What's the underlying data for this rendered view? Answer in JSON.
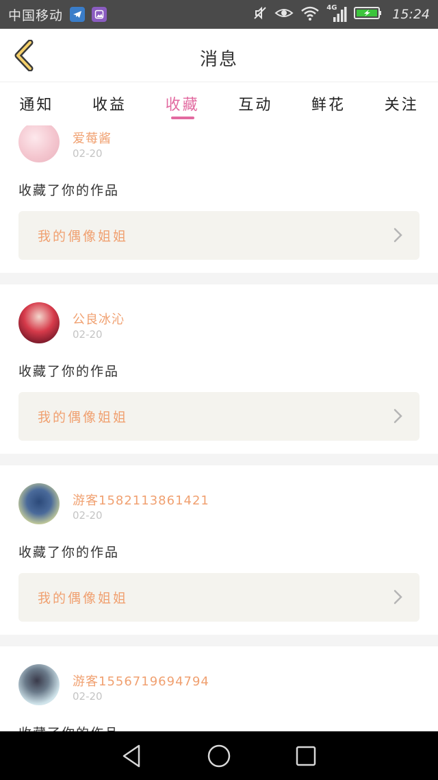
{
  "status_bar": {
    "carrier": "中国移动",
    "network": "4G",
    "time": "15:24"
  },
  "header": {
    "title": "消息"
  },
  "tabs": [
    {
      "label": "通知",
      "active": false
    },
    {
      "label": "收益",
      "active": false
    },
    {
      "label": "收藏",
      "active": true
    },
    {
      "label": "互动",
      "active": false
    },
    {
      "label": "鲜花",
      "active": false
    },
    {
      "label": "关注",
      "active": false
    }
  ],
  "items": [
    {
      "username": "爱莓酱",
      "date": "02-20",
      "action": "收藏了你的作品",
      "work_title": "我的偶像姐姐"
    },
    {
      "username": "公良冰沁",
      "date": "02-20",
      "action": "收藏了你的作品",
      "work_title": "我的偶像姐姐"
    },
    {
      "username": "游客15821138614​21",
      "date": "02-20",
      "action": "收藏了你的作品",
      "work_title": "我的偶像姐姐"
    },
    {
      "username": "游客1556719694794",
      "date": "02-20",
      "action": "收藏了你的作品",
      "work_title": ""
    }
  ],
  "colors": {
    "accent_pink": "#e26aa0",
    "username_orange": "#f0a070",
    "work_box_bg": "#f4f3ee",
    "status_bar_bg": "#4a4a4a"
  },
  "icons": {
    "back": "chevron-left-icon",
    "work_arrow": "chevron-right-icon",
    "nav_back": "triangle-back-icon",
    "nav_home": "circle-home-icon",
    "nav_recent": "square-recent-icon"
  }
}
